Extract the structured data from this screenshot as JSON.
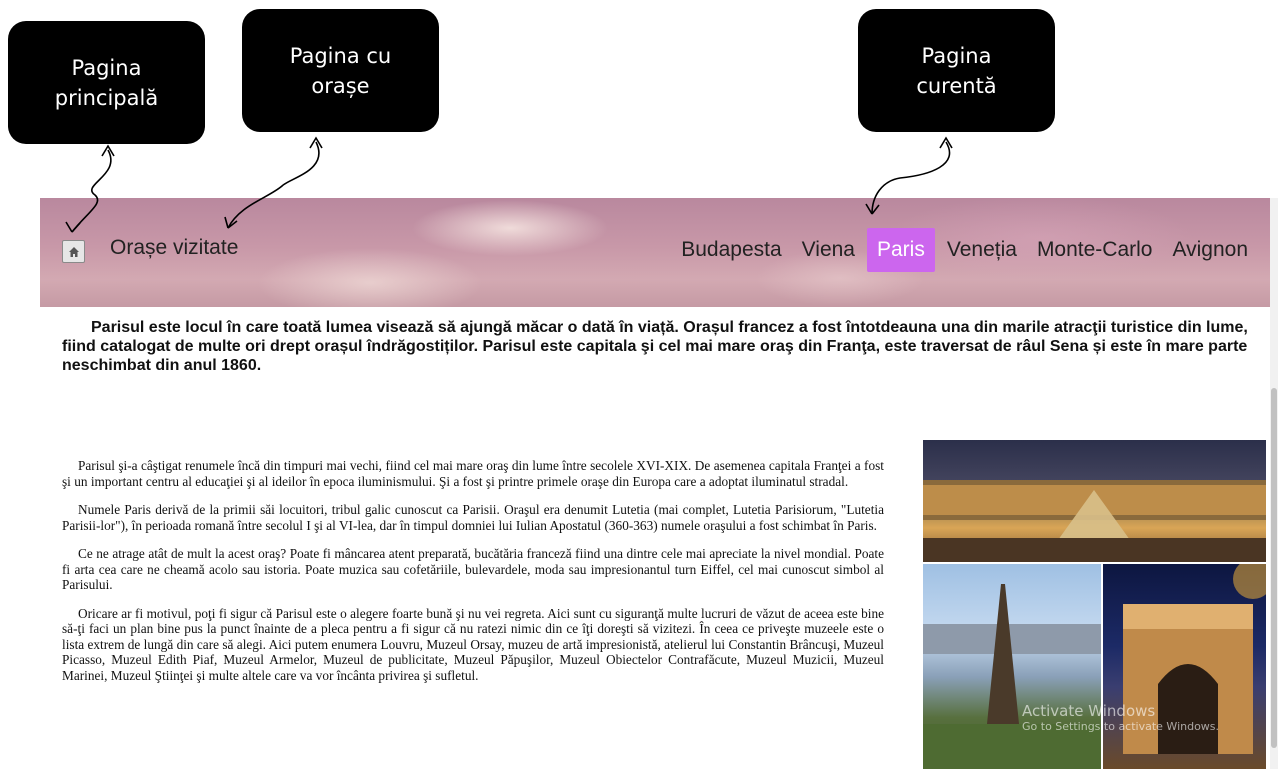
{
  "annotations": {
    "home": "Pagina\nprincipală",
    "cities": "Pagina cu\norașe",
    "current": "Pagina\ncurentă"
  },
  "header": {
    "home_icon": "home-icon",
    "site_title": "Orașe vizitate",
    "nav": [
      "Budapesta",
      "Viena",
      "Paris",
      "Veneția",
      "Monte-Carlo",
      "Avignon"
    ],
    "active": "Paris",
    "active_color": "#cc66ee"
  },
  "intro": "Parisul este locul în care toată lumea visează să ajungă măcar o dată în viață. Orașul francez a fost întotdeauna una din marile atracţii turistice din lume, fiind catalogat de multe ori drept orașul îndrăgostiților. Parisul este capitala şi cel mai mare oraş din Franţa, este traversat de râul Sena și este în mare parte neschimbat din anul 1860.",
  "article": [
    "Parisul şi-a câştigat renumele încă din timpuri mai vechi, fiind cel mai mare oraş din lume între secolele XVI-XIX. De asemenea capitala Franţei a fost şi un important centru al educaţiei şi al ideilor în epoca iluminismului. Şi a fost şi printre primele oraşe din Europa care a adoptat iluminatul stradal.",
    "Numele Paris derivă de la primii săi locuitori, tribul galic cunoscut ca Parisii. Oraşul era denumit Lutetia (mai complet, Lutetia Parisiorum, \"Lutetia Parisii-lor\"), în perioada romană între secolul I şi al VI-lea, dar în timpul domniei lui Iulian Apostatul (360-363) numele oraşului a fost schimbat în Paris.",
    "Ce ne atrage atât de mult la acest oraş? Poate fi mâncarea atent preparată, bucătăria franceză fiind una dintre cele mai apreciate la nivel mondial. Poate fi arta cea care ne cheamă acolo sau istoria. Poate muzica sau cofetăriile, bulevardele, moda sau impresionantul turn Eiffel, cel mai cunoscut simbol al Parisului.",
    "Oricare ar fi motivul, poţi fi sigur că Parisul este o alegere foarte bună şi nu vei regreta. Aici sunt cu siguranţă multe lucruri de văzut de aceea este bine să-ţi faci un plan bine pus la punct înainte de a pleca pentru a fi sigur că nu ratezi nimic din ce îţi doreşti să vizitezi. În ceea ce priveşte muzeele este o lista extrem de lungă din care să alegi. Aici putem enumera Louvru, Muzeul Orsay, muzeu de artă impresionistă, atelierul lui Constantin Brâncuşi, Muzeul Picasso, Muzeul Edith Piaf, Muzeul Armelor, Muzeul de publicitate, Muzeul Păpuşilor, Muzeul Obiectelor Contrafăcute, Muzeul Muzicii, Muzeul Marinei, Muzeul Ştiinţei şi multe altele care va vor încânta privirea şi sufletul."
  ],
  "watermark": {
    "line1": "Activate Windows",
    "line2": "Go to Settings to activate Windows."
  }
}
